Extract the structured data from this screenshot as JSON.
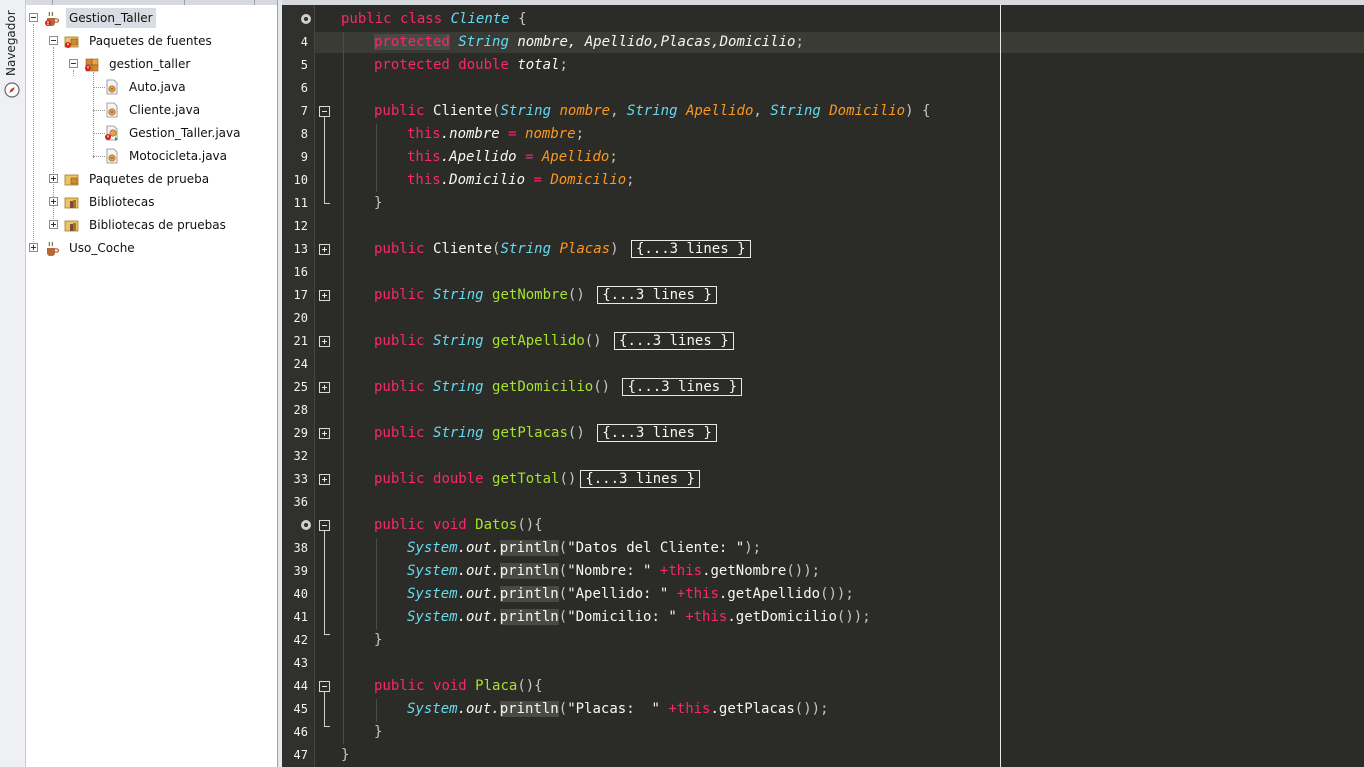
{
  "navigator_label": "Navegador",
  "tree": [
    {
      "label": "Gestion_Taller"
    },
    {
      "label": "Paquetes de fuentes"
    },
    {
      "label": "gestion_taller"
    },
    {
      "label": "Auto.java"
    },
    {
      "label": "Cliente.java"
    },
    {
      "label": "Gestion_Taller.java"
    },
    {
      "label": "Motocicleta.java"
    },
    {
      "label": "Paquetes de prueba"
    },
    {
      "label": "Bibliotecas"
    },
    {
      "label": "Bibliotecas de pruebas"
    },
    {
      "label": "Uso_Coche"
    }
  ],
  "code": {
    "line_numbers": [
      "",
      "4",
      "5",
      "6",
      "7",
      "8",
      "9",
      "10",
      "11",
      "12",
      "13",
      "16",
      "17",
      "20",
      "21",
      "24",
      "25",
      "28",
      "29",
      "32",
      "33",
      "36",
      "",
      "38",
      "39",
      "40",
      "41",
      "42",
      "43",
      "44",
      "45",
      "46",
      "47"
    ],
    "l0": {
      "kw1": "public",
      "kw2": "class",
      "name": "Cliente",
      "brace": "{"
    },
    "l4": {
      "kw": "protected",
      "type": "String",
      "fields": "nombre, Apellido,Placas,Domicilio",
      "end": ";"
    },
    "l5": {
      "kw": "protected",
      "type": "double",
      "field": "total",
      "end": ";"
    },
    "l7": {
      "kw": "public",
      "name": "Cliente",
      "open": "(",
      "t1": "String",
      "p1": "nombre",
      "c1": ", ",
      "t2": "String",
      "p2": "Apellido",
      "c2": ", ",
      "t3": "String",
      "p3": "Domicilio",
      "close": ") {"
    },
    "l8": {
      "this": "this",
      "field": ".nombre",
      "eq": " = ",
      "val": "nombre",
      "end": ";"
    },
    "l9": {
      "this": "this",
      "field": ".Apellido",
      "eq": " = ",
      "val": "Apellido",
      "end": ";"
    },
    "l10": {
      "this": "this",
      "field": ".Domicilio",
      "eq": " = ",
      "val": "Domicilio",
      "end": ";"
    },
    "l11": {
      "brace": "}"
    },
    "l13": {
      "kw": "public",
      "name": "Cliente",
      "open": "(",
      "type": "String",
      "param": "Placas",
      "close": ")",
      "folded": "{...3 lines }"
    },
    "l17": {
      "kw": "public",
      "type": "String",
      "name": "getNombre",
      "paren": "()",
      "folded": "{...3 lines }"
    },
    "l21": {
      "kw": "public",
      "type": "String",
      "name": "getApellido",
      "paren": "()",
      "folded": "{...3 lines }"
    },
    "l25": {
      "kw": "public",
      "type": "String",
      "name": "getDomicilio",
      "paren": "()",
      "folded": "{...3 lines }"
    },
    "l29": {
      "kw": "public",
      "type": "String",
      "name": "getPlacas",
      "paren": "()",
      "folded": "{...3 lines }"
    },
    "l33": {
      "kw1": "public",
      "kw2": "double",
      "name": "getTotal",
      "paren": "()",
      "folded": "{...3 lines }"
    },
    "l37": {
      "kw1": "public",
      "kw2": "void",
      "name": "Datos",
      "paren": "(){"
    },
    "l38": {
      "sys": "System",
      "out": ".out.",
      "call": "println",
      "open": "(",
      "str": "\"Datos del Cliente: \"",
      "close": ");"
    },
    "l39": {
      "sys": "System",
      "out": ".out.",
      "call": "println",
      "open": "(",
      "str": "\"Nombre: \"",
      "plus": " +",
      "this": "this",
      "rest": ".getNombre",
      "close": "());"
    },
    "l40": {
      "sys": "System",
      "out": ".out.",
      "call": "println",
      "open": "(",
      "str": "\"Apellido: \"",
      "plus": " +",
      "this": "this",
      "rest": ".getApellido",
      "close": "());"
    },
    "l41": {
      "sys": "System",
      "out": ".out.",
      "call": "println",
      "open": "(",
      "str": "\"Domicilio: \"",
      "plus": " +",
      "this": "this",
      "rest": ".getDomicilio",
      "close": "());"
    },
    "l42": {
      "brace": "}"
    },
    "l44": {
      "kw1": "public",
      "kw2": "void",
      "name": "Placa",
      "paren": "(){"
    },
    "l45": {
      "sys": "System",
      "out": ".out.",
      "call": "println",
      "open": "(",
      "str": "\"Placas:  \"",
      "plus": " +",
      "this": "this",
      "rest": ".getPlacas",
      "close": "());"
    },
    "l46": {
      "brace": "}"
    },
    "l47": {
      "brace": "}"
    }
  },
  "colors": {
    "editor_bg": "#2b2b27",
    "keyword": "#f92672",
    "type": "#66d9ef",
    "method": "#a6e22e",
    "string": "#e6db74",
    "parameter": "#fd971f"
  }
}
